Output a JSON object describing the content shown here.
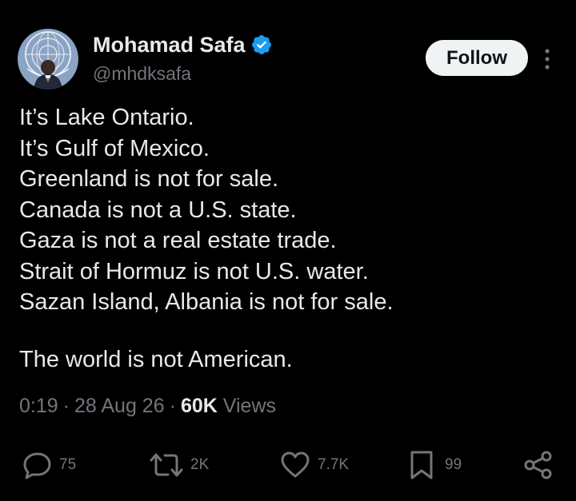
{
  "author": {
    "name": "Mohamad Safa",
    "handle": "@mhdksafa",
    "verified": true
  },
  "follow_label": "Follow",
  "tweet": {
    "lines": [
      "It’s Lake Ontario.",
      "It’s Gulf of Mexico.",
      "Greenland is not for sale.",
      "Canada is not a U.S. state.",
      "Gaza is not a real estate trade.",
      "Strait of Hormuz is not U.S. water.",
      "Sazan Island, Albania is not for sale."
    ],
    "closing": "The world is not American."
  },
  "meta": {
    "time": "0:19",
    "date": "28 Aug 26",
    "views_count": "60K",
    "views_label": "Views",
    "separator": "·"
  },
  "actions": {
    "replies": "75",
    "reposts": "2K",
    "likes": "7.7K",
    "bookmarks": "99"
  },
  "icons": {
    "verified": "verified-badge-icon",
    "more": "more-vertical-icon",
    "reply": "reply-icon",
    "repost": "repost-icon",
    "like": "heart-icon",
    "bookmark": "bookmark-icon",
    "share": "share-icon"
  },
  "colors": {
    "background": "#000000",
    "text": "#e7e9ea",
    "secondary": "#71767b",
    "verified": "#1d9bf0",
    "follow_bg": "#eff3f4"
  }
}
